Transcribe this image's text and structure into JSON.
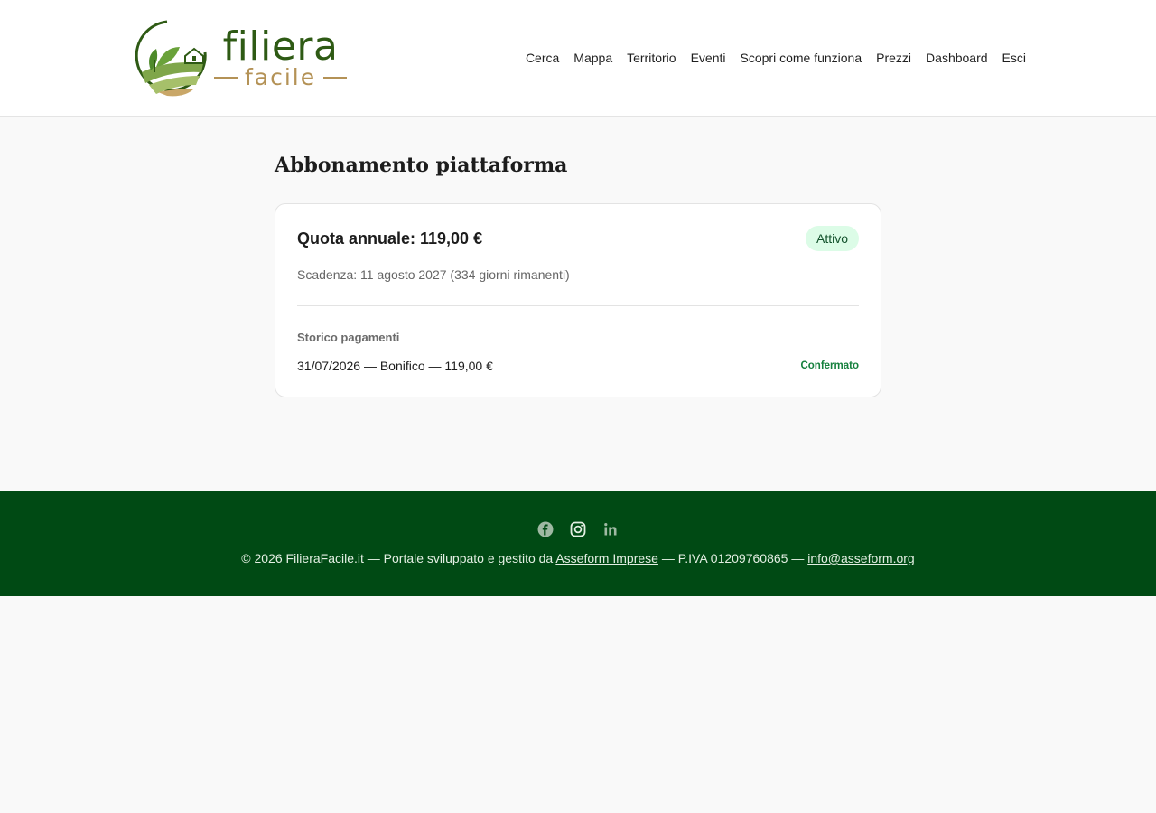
{
  "brand": {
    "name_main": "filiera",
    "name_sub": "facile"
  },
  "nav": {
    "items": [
      {
        "label": "Cerca"
      },
      {
        "label": "Mappa"
      },
      {
        "label": "Territorio"
      },
      {
        "label": "Eventi"
      },
      {
        "label": "Scopri come funziona"
      },
      {
        "label": "Prezzi"
      },
      {
        "label": "Dashboard"
      },
      {
        "label": "Esci"
      }
    ]
  },
  "page": {
    "title": "Abbonamento piattaforma",
    "quota": "Quota annuale: 119,00 €",
    "status_badge": "Attivo",
    "expiry": "Scadenza: 11 agosto 2027 (334 giorni rimanenti)",
    "history_heading": "Storico pagamenti",
    "payments": [
      {
        "description": "31/07/2026 — Bonifico — 119,00 €",
        "status": "Confermato"
      }
    ]
  },
  "footer": {
    "socials": [
      "facebook-icon",
      "instagram-icon",
      "linkedin-icon"
    ],
    "text_before": "© 2026 FilieraFacile.it — Portale sviluppato e gestito da",
    "company_link": "Asseform Imprese",
    "text_middle": "— P.IVA 01209760865 —",
    "email_link": "info@asseform.org"
  },
  "colors": {
    "brand_green": "#2e5a14",
    "brand_gold": "#b49256",
    "footer_bg": "#004a14",
    "badge_bg": "#dcfce7",
    "status_green": "#15803d"
  }
}
